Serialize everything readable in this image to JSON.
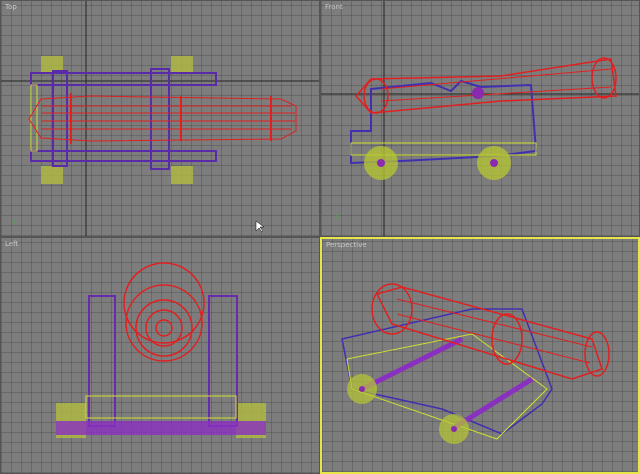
{
  "viewports": [
    {
      "label": "Top",
      "active": false
    },
    {
      "label": "Front",
      "active": false
    },
    {
      "label": "Left",
      "active": false
    },
    {
      "label": "Perspective",
      "active": true
    }
  ],
  "colors": {
    "barrel": "#e02020",
    "carriage": "#6a2ab0",
    "wheel": "#b8c830",
    "active_border": "#e6e64a",
    "background": "#7d7d7d"
  }
}
